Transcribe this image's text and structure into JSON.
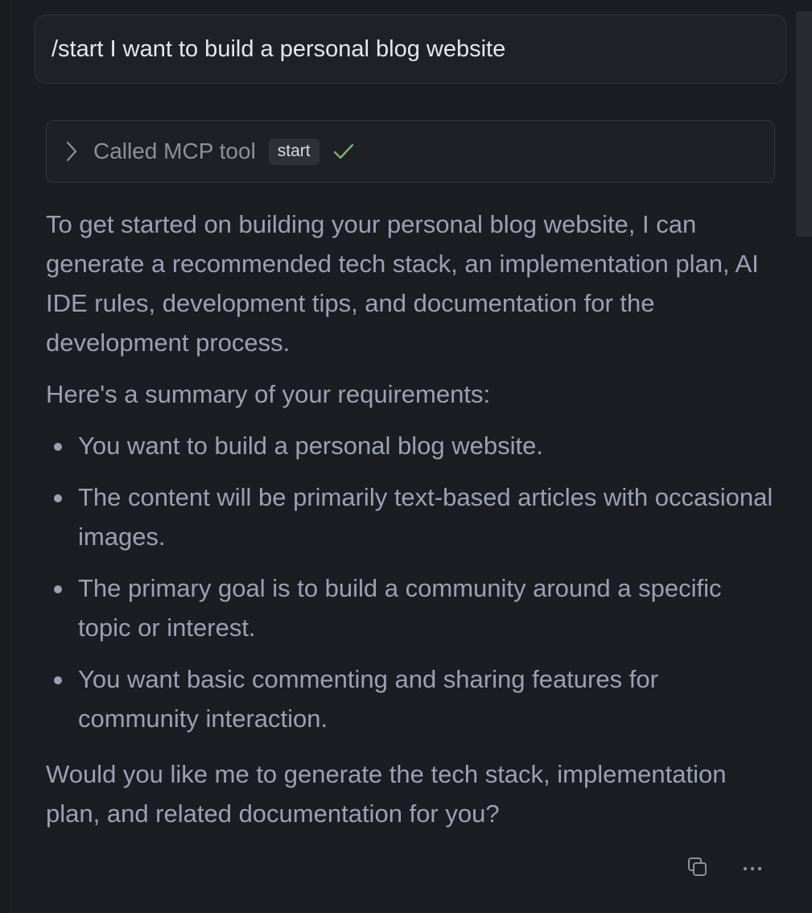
{
  "user_message": "/start I want to build a personal blog website",
  "tool_call": {
    "label": "Called MCP tool",
    "tool_name": "start",
    "status_icon": "check-icon",
    "status_color": "#7fae6f"
  },
  "assistant": {
    "intro": "To get started on building your personal blog website, I can generate a recommended tech stack, an implementation plan, AI IDE rules, development tips, and documentation for the development process.",
    "summary_heading": "Here's a summary of your requirements:",
    "requirements": [
      "You want to build a personal blog website.",
      "The content will be primarily text-based articles with occasional images.",
      "The primary goal is to build a community around a specific topic or interest.",
      "You want basic commenting and sharing features for community interaction."
    ],
    "question": "Would you like me to generate the tech stack, implementation plan, and related documentation for you?"
  },
  "actions": {
    "copy_icon": "copy-icon",
    "more_icon": "more-horizontal-icon"
  },
  "colors": {
    "background": "#1c1d22",
    "text": "#9aa1b5",
    "user_text": "#e6e7ea"
  }
}
